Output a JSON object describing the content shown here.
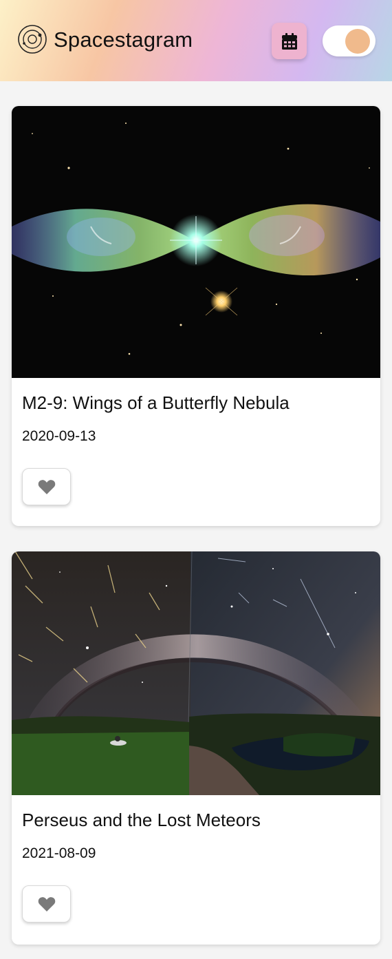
{
  "header": {
    "brand": "Spacestagram",
    "logo_icon": "orbit-logo-icon",
    "calendar_icon": "calendar-icon",
    "theme_toggle_icon": "theme-toggle"
  },
  "colors": {
    "calendar_button": "#eeb3cf",
    "toggle_knob": "#f0ba8c",
    "like_heart": "#7a7a7a"
  },
  "posts": [
    {
      "title": "M2-9: Wings of a Butterfly Nebula",
      "date": "2020-09-13",
      "like_icon": "heart-icon",
      "image_subject": "butterfly-nebula-image"
    },
    {
      "title": "Perseus and the Lost Meteors",
      "date": "2021-08-09",
      "like_icon": "heart-icon",
      "image_subject": "meteor-shower-milky-way-image"
    }
  ]
}
